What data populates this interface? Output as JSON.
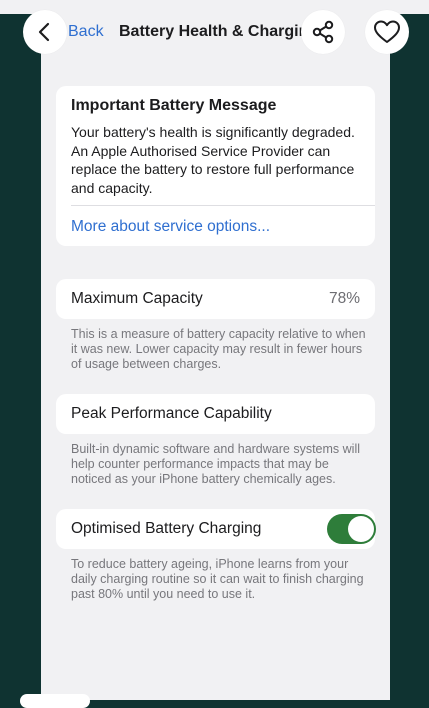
{
  "nav": {
    "back_label": "Back",
    "title": "Battery Health & Charging",
    "icons": [
      "chevron-left-icon",
      "share-icon",
      "heart-icon"
    ]
  },
  "important_message": {
    "title": "Important Battery Message",
    "body": "Your battery's health is significantly degraded. An Apple Authorised Service Provider can replace the battery to restore full performance and capacity.",
    "link": "More about service options..."
  },
  "maximum_capacity": {
    "label": "Maximum Capacity",
    "value": "78%",
    "note": "This is a measure of battery capacity relative to when it was new. Lower capacity may result in fewer hours of usage between charges."
  },
  "peak_performance": {
    "label": "Peak Performance Capability",
    "note": "Built-in dynamic software and hardware systems will help counter performance impacts that may be noticed as your iPhone battery chemically ages."
  },
  "optimised_charging": {
    "label": "Optimised Battery Charging",
    "enabled": true,
    "note": "To reduce battery ageing, iPhone learns from your daily charging routine so it can wait to finish charging past 80% until you need to use it."
  },
  "colors": {
    "accent_blue": "#2f6fd0",
    "toggle_on": "#2e7d3a",
    "backdrop": "#0f3331",
    "grouped_background": "#f1f1f3"
  }
}
